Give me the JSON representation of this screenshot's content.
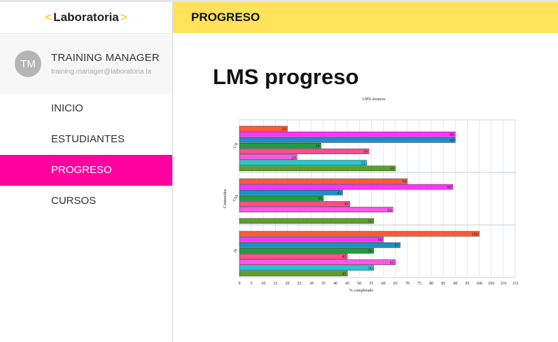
{
  "brand": {
    "left": "<",
    "word": "Laboratoria",
    "right": ">"
  },
  "profile": {
    "initials": "TM",
    "name": "TRAINING MANAGER",
    "email": "training.manager@laboratoria.la"
  },
  "nav": [
    {
      "label": "INICIO",
      "active": false
    },
    {
      "label": "ESTUDIANTES",
      "active": false
    },
    {
      "label": "PROGRESO",
      "active": true
    },
    {
      "label": "CURSOS",
      "active": false
    }
  ],
  "header": {
    "title": "PROGRESO"
  },
  "page": {
    "title": "LMS progreso"
  },
  "chart_data": {
    "type": "bar",
    "orientation": "horizontal",
    "title": "LMS avances",
    "xlabel": "% completado",
    "ylabel": "Contenidos",
    "xlim": [
      0,
      115
    ],
    "xticks": [
      0,
      5,
      10,
      15,
      20,
      25,
      30,
      35,
      40,
      45,
      50,
      55,
      60,
      65,
      70,
      75,
      80,
      85,
      90,
      95,
      100,
      105,
      110,
      115
    ],
    "grid": true,
    "legend": "none",
    "groups": [
      {
        "category": "UX",
        "values": [
          20,
          90,
          90,
          34,
          54,
          24,
          53,
          65
        ]
      },
      {
        "category": "CSS",
        "values": [
          70,
          89,
          43,
          35,
          46,
          64,
          null,
          56
        ]
      },
      {
        "category": "JS",
        "values": [
          100,
          60,
          67,
          56,
          45,
          65,
          56,
          45
        ]
      }
    ],
    "bar_colors": [
      "#ff5a36",
      "#ff33ff",
      "#1a8fc9",
      "#1f9e3d",
      "#ff4d8d",
      "#ff55e8",
      "#22c9cf",
      "#5f9e2a"
    ]
  }
}
